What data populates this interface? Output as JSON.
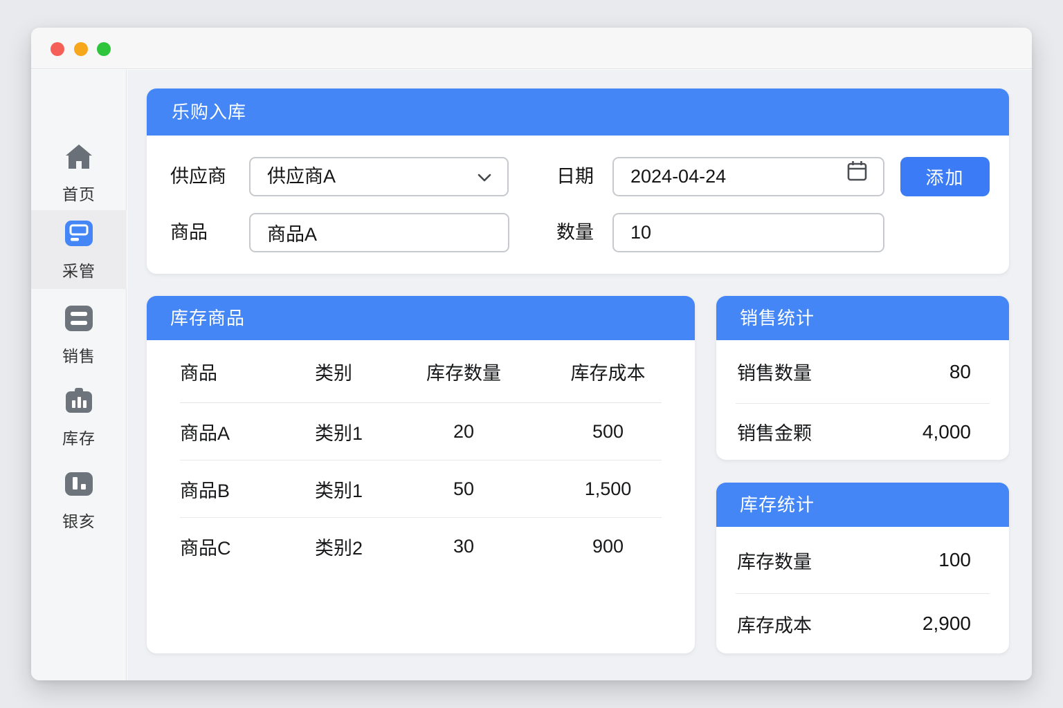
{
  "colors": {
    "accent": "#4486f6",
    "button_blue": "#3b7cf6",
    "traffic_red": "#f65f57",
    "traffic_yellow": "#f7a71b",
    "traffic_green": "#2ec53c"
  },
  "sidebar": {
    "items": [
      {
        "label": "首页",
        "icon": "home-icon",
        "active": false
      },
      {
        "label": "采管",
        "icon": "procurement-icon",
        "active": true
      },
      {
        "label": "销售",
        "icon": "sales-icon",
        "active": false
      },
      {
        "label": "库存",
        "icon": "inventory-icon",
        "active": false
      },
      {
        "label": "银亥",
        "icon": "reports-icon",
        "active": false
      }
    ]
  },
  "purchase_form": {
    "title": "乐购入库",
    "supplier_label": "供应商",
    "supplier_value": "供应商A",
    "product_label": "商品",
    "product_value": "商品A",
    "date_label": "日期",
    "date_value": "2024-04-24",
    "quantity_label": "数量",
    "quantity_value": "10",
    "add_button_label": "添加"
  },
  "inventory_table": {
    "title": "库存商品",
    "columns": [
      "商品",
      "类别",
      "库存数量",
      "库存成本"
    ],
    "rows": [
      [
        "商品A",
        "类别1",
        "20",
        "500"
      ],
      [
        "商品B",
        "类别1",
        "50",
        "1,500"
      ],
      [
        "商品C",
        "类别2",
        "30",
        "900"
      ]
    ]
  },
  "sales_stats": {
    "title": "销售统计",
    "rows": [
      {
        "label": "销售数量",
        "value": "80"
      },
      {
        "label": "销售金颗",
        "value": "4,000"
      }
    ]
  },
  "inventory_stats": {
    "title": "库存统计",
    "rows": [
      {
        "label": "库存数量",
        "value": "100"
      },
      {
        "label": "库存成本",
        "value": "2,900"
      }
    ]
  }
}
